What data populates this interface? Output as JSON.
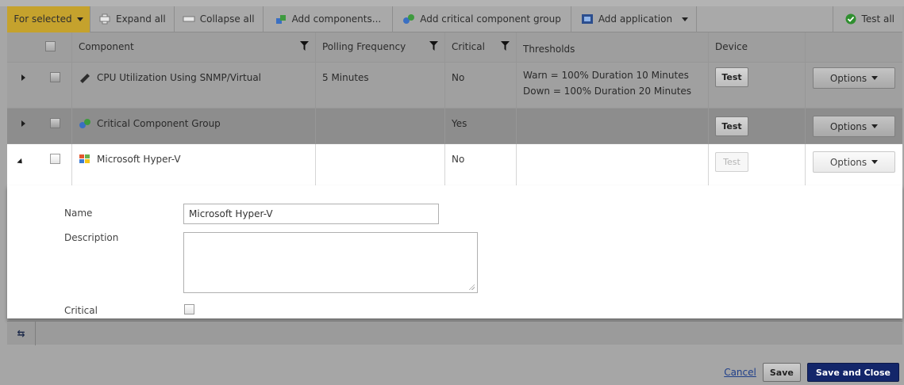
{
  "toolbar": {
    "for_selected": "For selected",
    "expand_all": "Expand all",
    "collapse_all": "Collapse all",
    "add_components": "Add components...",
    "add_critical_group": "Add critical component group",
    "add_application": "Add application",
    "test_all": "Test all"
  },
  "columns": {
    "component": "Component",
    "polling": "Polling Frequency",
    "critical": "Critical",
    "thresholds": "Thresholds",
    "device": "Device"
  },
  "rows": [
    {
      "name": "CPU Utilization Using SNMP/Virtual",
      "polling": "5 Minutes",
      "critical": "No",
      "threshold_warn": "Warn = 100% Duration 10 Minutes",
      "threshold_down": "Down = 100% Duration 20 Minutes",
      "test": "Test",
      "options": "Options"
    },
    {
      "name": "Critical Component Group",
      "polling": "",
      "critical": "Yes",
      "test": "Test",
      "options": "Options"
    },
    {
      "name": "Microsoft Hyper-V",
      "polling": "",
      "critical": "No",
      "test": "Test",
      "options": "Options"
    }
  ],
  "detail": {
    "name_label": "Name",
    "name_value": "Microsoft Hyper-V",
    "description_label": "Description",
    "description_value": "",
    "critical_label": "Critical"
  },
  "footer": {
    "cancel": "Cancel",
    "save": "Save",
    "save_close": "Save and Close"
  },
  "colors": {
    "for_selected_bg": "#c5a22d",
    "primary_button": "#13266a",
    "link": "#1f3f8a"
  }
}
